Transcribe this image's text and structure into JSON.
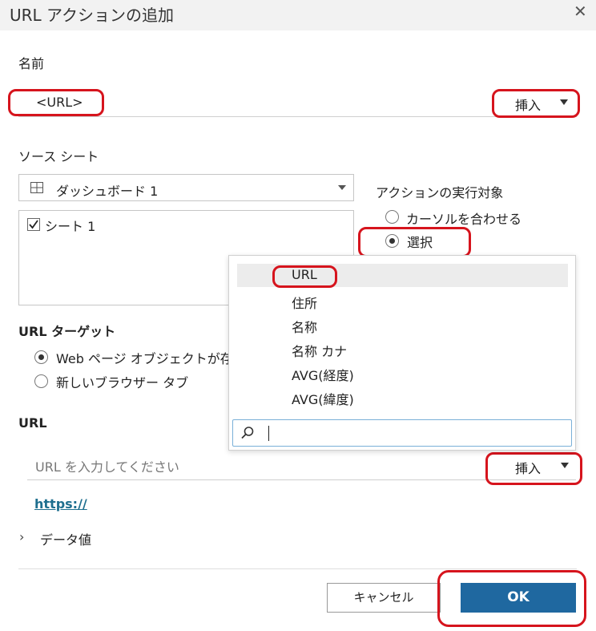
{
  "dialog": {
    "title": "URL アクションの追加",
    "close_icon": "close-icon"
  },
  "name_section": {
    "label": "名前",
    "value": "<URL>",
    "insert_label": "挿入"
  },
  "source_sheet": {
    "label": "ソース シート",
    "selected": "ダッシュボード 1",
    "sheets": [
      {
        "label": "シート 1",
        "checked": true
      }
    ]
  },
  "run_action_on": {
    "label": "アクションの実行対象",
    "options": [
      {
        "label": "カーソルを合わせる",
        "selected": false
      },
      {
        "label": "選択",
        "selected": true
      }
    ]
  },
  "url_target": {
    "label": "URL ターゲット",
    "options": [
      {
        "label": "Web ページ オブジェクトが存在",
        "selected": true
      },
      {
        "label": "新しいブラウザー タブ",
        "selected": false
      }
    ]
  },
  "url_section": {
    "label": "URL",
    "placeholder": "URL を入力してください",
    "insert_label": "挿入",
    "link_text": "https://"
  },
  "data_values": {
    "label": "データ値"
  },
  "insert_dropdown": {
    "items": [
      "URL",
      "住所",
      "名称",
      "名称 カナ",
      "AVG(経度)",
      "AVG(緯度)"
    ],
    "highlighted_index": 0,
    "search_value": ""
  },
  "buttons": {
    "cancel": "キャンセル",
    "ok": "OK"
  },
  "colors": {
    "primary": "#1f68a0",
    "annotation": "#d6141d",
    "link": "#1f6f8f"
  }
}
